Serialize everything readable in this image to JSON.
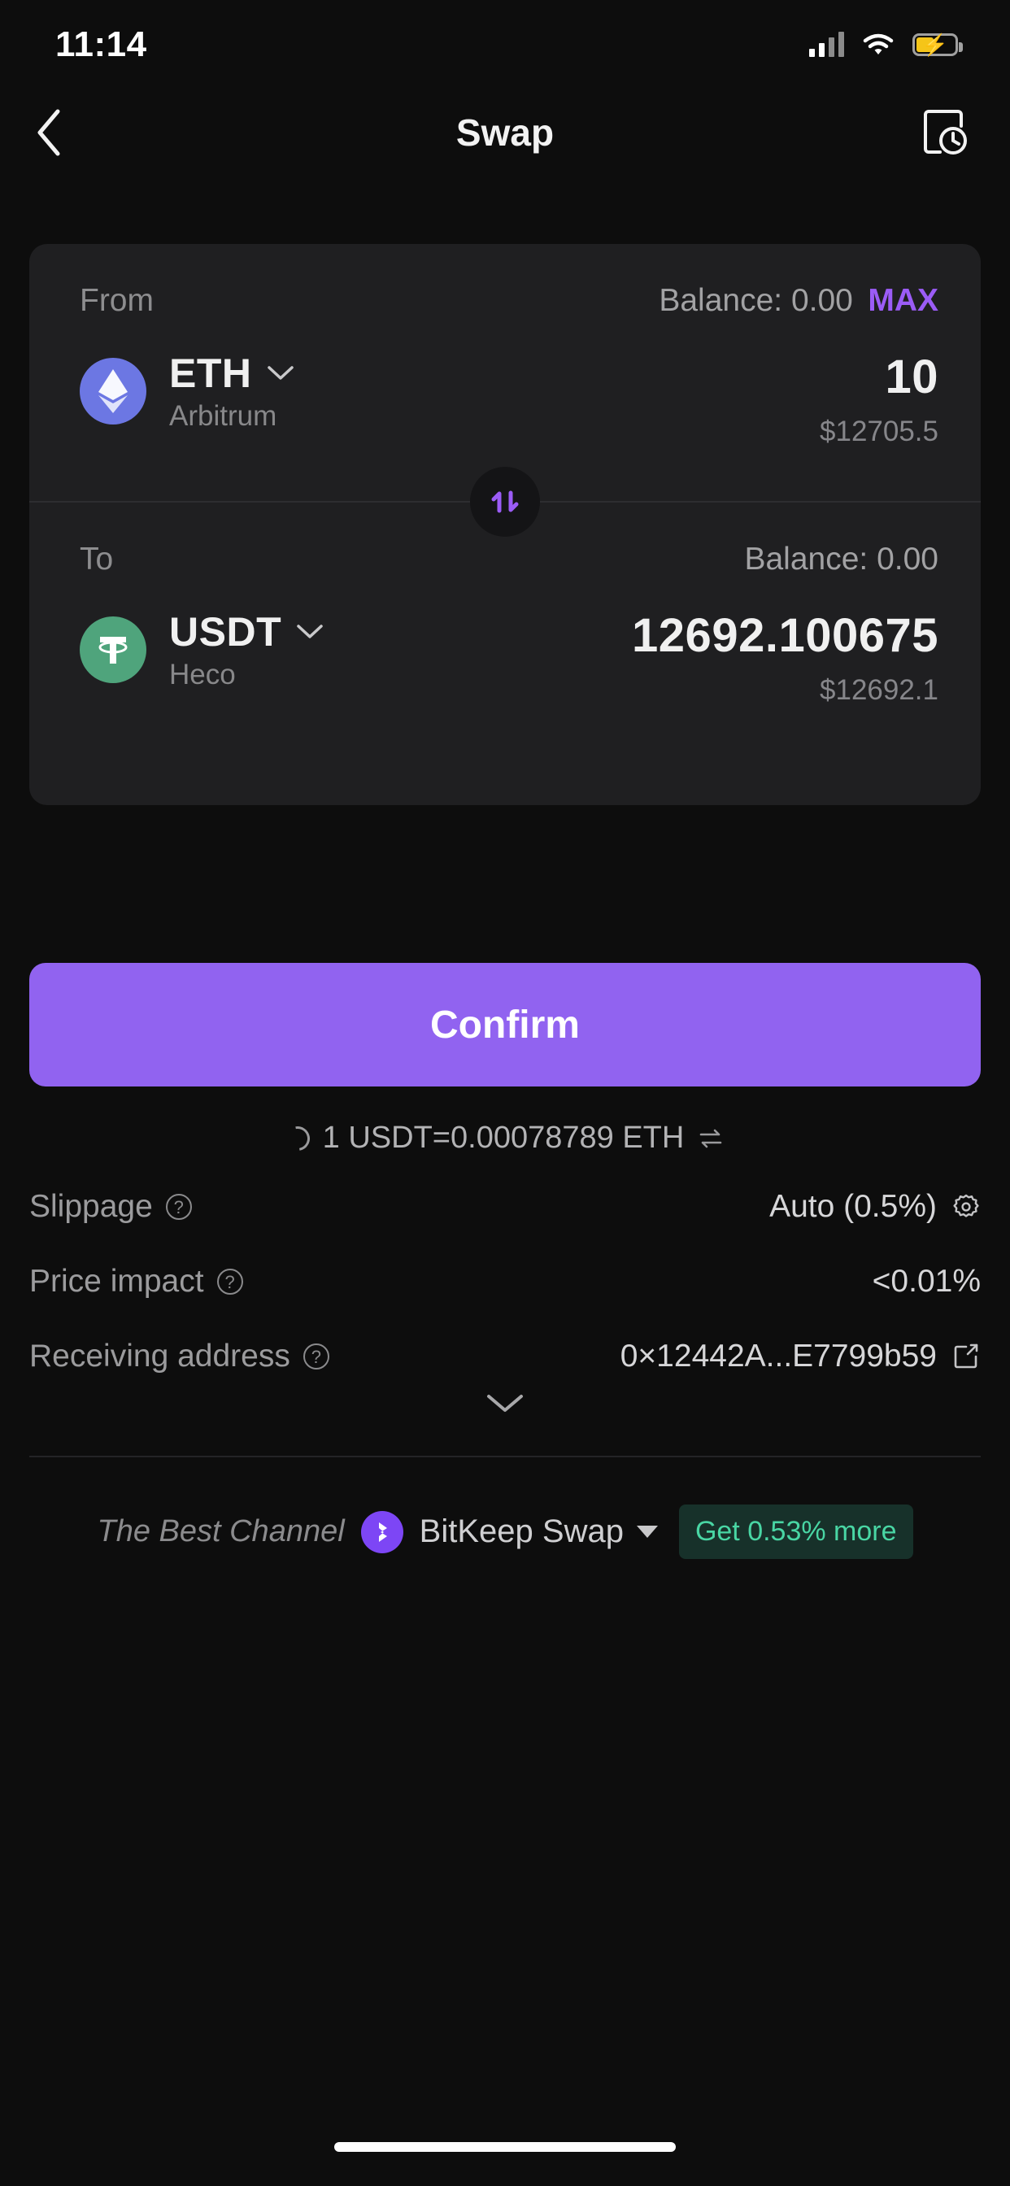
{
  "status_bar": {
    "time": "11:14",
    "signal_icon": "cellular-signal-icon",
    "wifi_icon": "wifi-icon",
    "battery_icon": "battery-charging-icon",
    "battery_charging_glyph": "⚡"
  },
  "nav": {
    "back_icon": "chevron-left-icon",
    "title": "Swap",
    "history_icon": "history-clock-icon"
  },
  "swap": {
    "from": {
      "label": "From",
      "balance_label": "Balance: 0.00",
      "max_label": "MAX",
      "token_symbol": "ETH",
      "token_network": "Arbitrum",
      "token_icon": "ethereum-icon",
      "amount": "10",
      "amount_usd": "$12705.5",
      "chevron_icon": "chevron-down-icon"
    },
    "toggle_icon": "swap-vertical-arrows-icon",
    "to": {
      "label": "To",
      "balance_label": "Balance: 0.00",
      "token_symbol": "USDT",
      "token_network": "Heco",
      "token_icon": "tether-icon",
      "amount": "12692.100675",
      "amount_usd": "$12692.1",
      "chevron_icon": "chevron-down-icon"
    }
  },
  "confirm_button": {
    "label": "Confirm"
  },
  "rate": {
    "spinner_icon": "loading-spinner-icon",
    "text": "1 USDT=0.00078789 ETH",
    "toggle_icon": "swap-horizontal-arrows-icon"
  },
  "details": [
    {
      "label": "Slippage",
      "help_icon": "question-mark-icon",
      "value": "Auto (0.5%)",
      "trailing_icon": "gear-icon"
    },
    {
      "label": "Price impact",
      "help_icon": "question-mark-icon",
      "value": "<0.01%",
      "trailing_icon": ""
    },
    {
      "label": "Receiving address",
      "help_icon": "question-mark-icon",
      "value": "0×12442A...E7799b59",
      "trailing_icon": "edit-square-icon"
    }
  ],
  "expand_icon": "chevron-down-icon",
  "channel": {
    "label": "The Best Channel",
    "logo_icon": "bitkeep-logo-icon",
    "name": "BitKeep Swap",
    "caret_icon": "caret-down-icon",
    "badge": "Get 0.53% more"
  },
  "colors": {
    "accent_purple": "#9163f0",
    "max_purple": "#9b5cf6",
    "eth_blue": "#6c77e3",
    "usdt_green": "#4fa47c",
    "badge_green": "#49d6a4",
    "battery_yellow": "#f5c518",
    "card_bg": "#1f1f21",
    "page_bg": "#0d0d0d"
  },
  "home_indicator": "home-indicator"
}
